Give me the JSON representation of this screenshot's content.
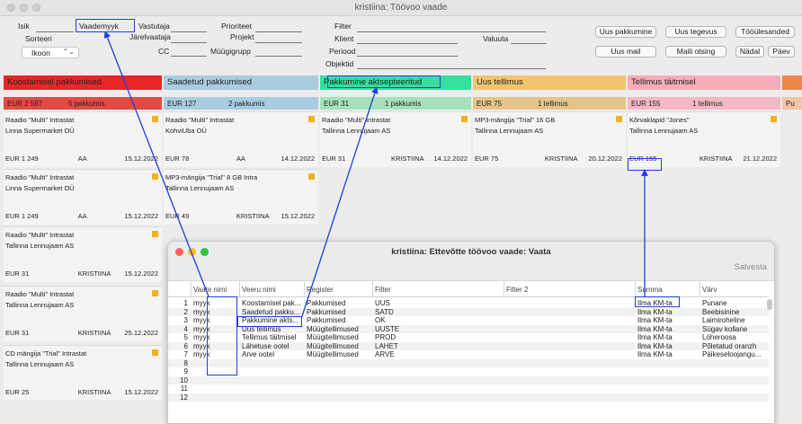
{
  "window": {
    "title": "kristiina: Töövoo vaade"
  },
  "filters": {
    "isik": "Isik",
    "vaade_label": "Vaade",
    "vaade_value": "myyk",
    "vastutaja": "Vastutaja",
    "prioriteet": "Prioriteet",
    "sorteeri": "Sorteeri",
    "jarelvaataja": "Järelvaataja",
    "projekt": "Projekt",
    "cc": "CC",
    "muugigrupp": "Müügigrupp",
    "sort_value": "Ikoon",
    "filter": "Filter",
    "klient": "Klient",
    "valuuta": "Valuuta",
    "periood": "Periood",
    "objektid": "Objektid"
  },
  "buttons": {
    "uus_pakkumine": "Uus pakkumine",
    "uus_tegevus": "Uus tegevus",
    "tooulesanded": "Tööülesanded",
    "uus_mail": "Uus mail",
    "maili_otsing": "Maili otsing",
    "nadal": "Nädal",
    "paev": "Päev"
  },
  "stages": [
    {
      "label": "Koostamisel pakkumised",
      "color": "#e8262a",
      "bar": "#e24a44",
      "cur": "EUR 2 587",
      "count": "5 pakkumis"
    },
    {
      "label": "Saadetud pakkumised",
      "color": "#a9cde0",
      "bar": "#a9cde0",
      "cur": "EUR 127",
      "count": "2 pakkumis"
    },
    {
      "label": "Pakkumine aktsepteeritud",
      "color": "#35df9e",
      "bar": "#a5e2bb",
      "cur": "EUR 31",
      "count": "1 pakkumis"
    },
    {
      "label": "Uus tellimus",
      "color": "#f1c56f",
      "bar": "#e6c489",
      "cur": "EUR 75",
      "count": "1 tellimus"
    },
    {
      "label": "Tellimus täitmisel",
      "color": "#f7adb9",
      "bar": "#f4b9c2",
      "cur": "EUR 155",
      "count": "1 tellimus"
    },
    {
      "label": "",
      "color": "#f0854a",
      "bar": "#f3c4a8",
      "cur": "Pu",
      "count": ""
    }
  ],
  "cards": {
    "col1": [
      {
        "l1": "Raadio \"Multi\" Intrastat",
        "l2": "Linna Supermarket OÜ",
        "amount": "EUR 1 249",
        "person": "AA",
        "date": "15.12.2022"
      },
      {
        "l1": "Raadio \"Multi\" Intrastat",
        "l2": "Linna Supermarket OÜ",
        "amount": "EUR 1 249",
        "person": "AA",
        "date": "15.12.2022"
      },
      {
        "l1": "Raadio \"Multi\" Intrastat",
        "l2": "Tallinna Lennujaam AS",
        "amount": "EUR 31",
        "person": "KRISTIINA",
        "date": "15.12.2022"
      },
      {
        "l1": "Raadio \"Multi\" Intrastat",
        "l2": "Tallinna Lennujaam AS",
        "amount": "EUR 31",
        "person": "KRISTIINA",
        "date": "25.12.2022"
      },
      {
        "l1": "CD mängija \"Trial\" Intrastat",
        "l2": "Tallinna Lennujaam AS",
        "amount": "EUR 25",
        "person": "KRISTIINA",
        "date": "15.12.2022"
      }
    ],
    "col2": [
      {
        "l1": "Raadio \"Multi\" Intrastat",
        "l2": "KohviUba OÜ",
        "amount": "EUR 78",
        "person": "AA",
        "date": "14.12.2022"
      },
      {
        "l1": "MP3-mängija \"Trial\" 8 GB Intra",
        "l2": "Tallinna Lennujaam AS",
        "amount": "EUR 49",
        "person": "KRISTIINA",
        "date": "15.12.2022"
      }
    ],
    "col3": [
      {
        "l1": "Raadio \"Multi\" Intrastat",
        "l2": "Tallinna Lennujaam AS",
        "amount": "EUR 31",
        "person": "KRISTIINA",
        "date": "14.12.2022"
      }
    ],
    "col4": [
      {
        "l1": "MP3-mängija \"Trial\" 16 GB",
        "l2": "Tallinna Lennujaam AS",
        "amount": "EUR 75",
        "person": "KRISTIINA",
        "date": "20.12.2022"
      }
    ],
    "col5": [
      {
        "l1": "Kõrvaklapid \"Jones\"",
        "l2": "Tallinna Lennujaam AS",
        "amount": "EUR 155",
        "person": "KRISTIINA",
        "date": "21.12.2022"
      }
    ]
  },
  "dialog": {
    "title": "kristiina: Ettevõtte töövoo vaade: Vaata",
    "save": "Salvesta",
    "headers": [
      "Vaate nimi",
      "Veeru nimi",
      "Register",
      "Filter",
      "Filter 2",
      "Summa",
      "Värv"
    ],
    "rows": [
      [
        "1",
        "myyk",
        "Koostamisel pak...",
        "Pakkumised",
        "UUS",
        "",
        "Ilma KM-ta",
        "Punane"
      ],
      [
        "2",
        "myyk",
        "Saadetud pakku...",
        "Pakkumised",
        "SATD",
        "",
        "Ilma KM-ta",
        "Beebisinine"
      ],
      [
        "3",
        "myyk",
        "Pakkumine akts...",
        "Pakkumised",
        "OK",
        "",
        "Ilma KM-ta",
        "Laimiroheline"
      ],
      [
        "4",
        "myyk",
        "Uus tellimus",
        "Müügitellimused",
        "UUSTE",
        "",
        "Ilma KM-ta",
        "Sügav kollane"
      ],
      [
        "5",
        "myyk",
        "Tellimus täitmisel",
        "Müügitellimused",
        "PROD",
        "",
        "Ilma KM-ta",
        "Löheroosa"
      ],
      [
        "6",
        "myyk",
        "Lähetuse ootel",
        "Müügitellimused",
        "LAHET",
        "",
        "Ilma KM-ta",
        "Põletatud oranzh"
      ],
      [
        "7",
        "myyk",
        "Arve ootel",
        "Müügitellimused",
        "ARVE",
        "",
        "Ilma KM-ta",
        "Päikeseloojangu..."
      ],
      [
        "8",
        "",
        "",
        "",
        "",
        "",
        "",
        ""
      ],
      [
        "9",
        "",
        "",
        "",
        "",
        "",
        "",
        ""
      ],
      [
        "10",
        "",
        "",
        "",
        "",
        "",
        "",
        ""
      ],
      [
        "11",
        "",
        "",
        "",
        "",
        "",
        "",
        ""
      ],
      [
        "12",
        "",
        "",
        "",
        "",
        "",
        "",
        ""
      ]
    ]
  }
}
